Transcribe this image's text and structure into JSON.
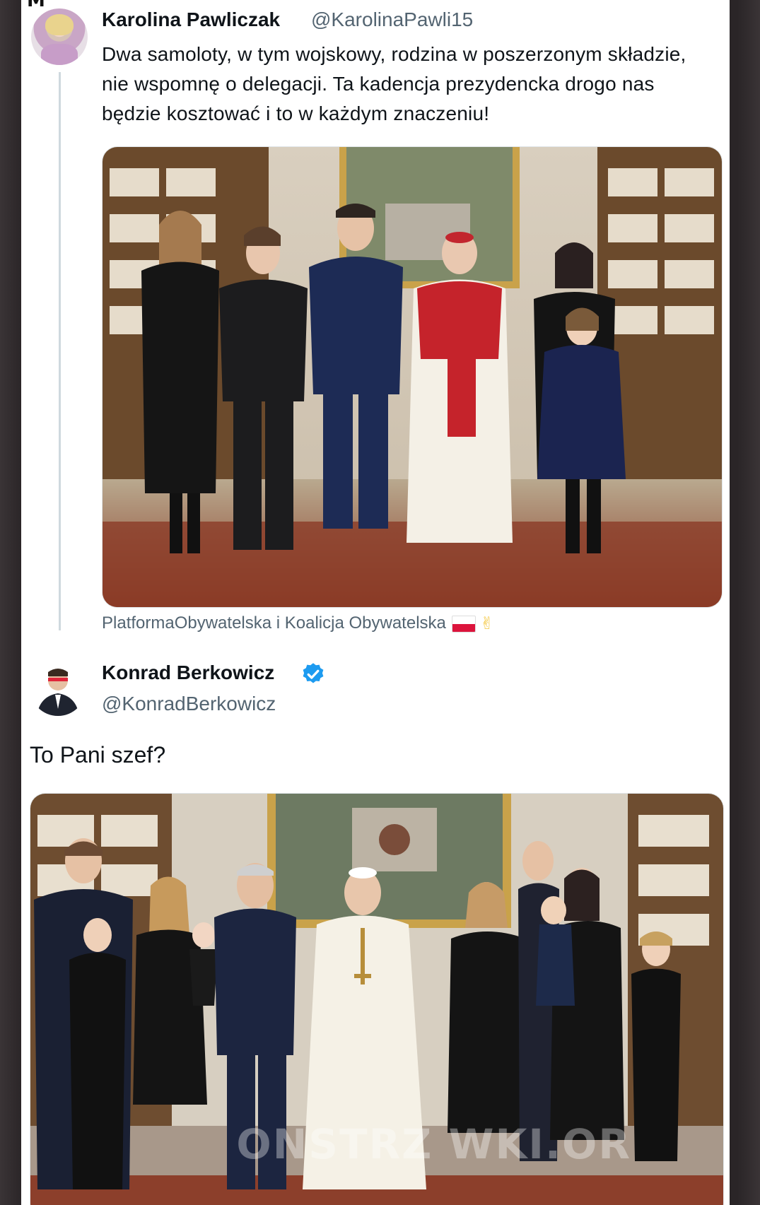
{
  "corner_mark": "M",
  "original_tweet": {
    "author_name": "Karolina Pawliczak",
    "author_handle": "@KarolinaPawli15",
    "text": "Dwa samoloty, w tym wojskowy, rodzina w poszerzonym składzie, nie wspomnę o delegacji. Ta kadencja prezydencka drogo nas będzie kosztować i to w każdym znaczeniu!",
    "caption": "PlatformaObywatelska i Koalicja Obywatelska",
    "avatar_icon": "profile-photo"
  },
  "reply_tweet": {
    "author_name": "Konrad Berkowicz",
    "author_handle": "@KonradBerkowicz",
    "verified_icon": "verified-badge-icon",
    "verified_color": "#1d9bf0",
    "text": "To Pani szef?",
    "avatar_icon": "profile-photo"
  },
  "watermark": "ONSTRZ WKI.OR",
  "colors": {
    "name": "#0f1419",
    "handle": "#536471",
    "thread_line": "#cfd9de"
  }
}
